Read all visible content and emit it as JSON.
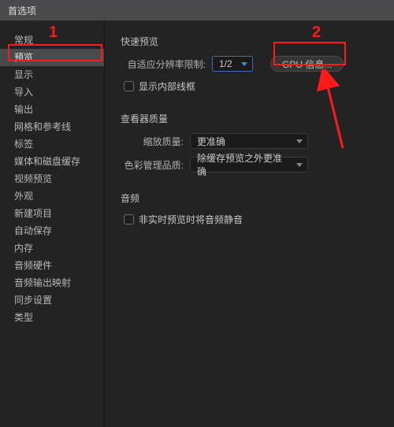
{
  "window": {
    "title": "首选项"
  },
  "sidebar": {
    "items": [
      {
        "label": "常规"
      },
      {
        "label": "预览"
      },
      {
        "label": "显示"
      },
      {
        "label": "导入"
      },
      {
        "label": "输出"
      },
      {
        "label": "网格和参考线"
      },
      {
        "label": "标签"
      },
      {
        "label": "媒体和磁盘缓存"
      },
      {
        "label": "视频预览"
      },
      {
        "label": "外观"
      },
      {
        "label": "新建项目"
      },
      {
        "label": "自动保存"
      },
      {
        "label": "内存"
      },
      {
        "label": "音频硬件"
      },
      {
        "label": "音频输出映射"
      },
      {
        "label": "同步设置"
      },
      {
        "label": "类型"
      }
    ],
    "selected_index": 1
  },
  "main": {
    "fast_preview": {
      "title": "快速预览",
      "resolution_label": "自适应分辨率限制:",
      "resolution_value": "1/2",
      "gpu_button": "GPU 信息...",
      "show_wireframe": "显示内部线框"
    },
    "viewer_quality": {
      "title": "查看器质量",
      "zoom_label": "缩放质量:",
      "zoom_value": "更准确",
      "color_label": "色彩管理品质:",
      "color_value": "除缓存预览之外更准确"
    },
    "audio": {
      "title": "音频",
      "mute_label": "非实时预览时将音频静音"
    }
  },
  "annotations": {
    "num1": "1",
    "num2": "2"
  }
}
